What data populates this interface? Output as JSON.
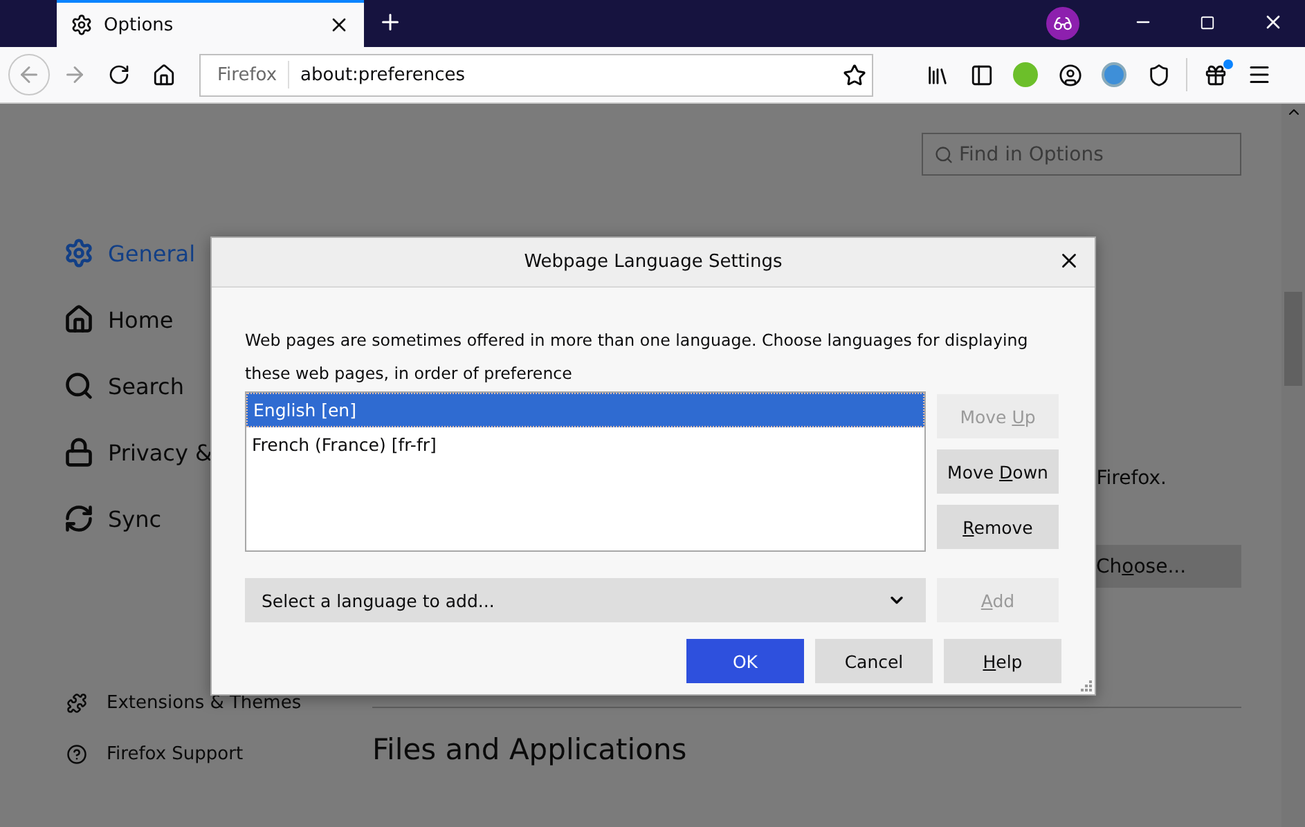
{
  "tab": {
    "title": "Options",
    "selected": true
  },
  "address_bar": {
    "identity": "Firefox",
    "url": "about:preferences"
  },
  "search": {
    "placeholder": "Find in Options"
  },
  "sidebar": {
    "items": [
      {
        "label": "General",
        "selected": true
      },
      {
        "label": "Home",
        "selected": false
      },
      {
        "label": "Search",
        "selected": false
      },
      {
        "label": "Privacy & ",
        "selected": false
      },
      {
        "label": "Sync",
        "selected": false
      }
    ],
    "footer_links": [
      "Extensions & Themes",
      "Firefox Support"
    ]
  },
  "content": {
    "text_fragment": "Firefox.",
    "choose_button": {
      "before": "Ch",
      "key": "o",
      "after": "ose..."
    },
    "section_heading": "Files and Applications"
  },
  "dialog": {
    "title": "Webpage Language Settings",
    "description": "Web pages are sometimes offered in more than one language. Choose languages for displaying these web pages, in order of preference",
    "languages": [
      {
        "label": "English [en]",
        "selected": true
      },
      {
        "label": "French (France) [fr-fr]",
        "selected": false
      }
    ],
    "side_buttons": [
      {
        "before": "Move ",
        "key": "U",
        "after": "p",
        "disabled": true
      },
      {
        "before": "Move ",
        "key": "D",
        "after": "own",
        "disabled": false
      },
      {
        "key": "R",
        "after": "emove",
        "disabled": false
      }
    ],
    "add_select": {
      "placeholder": "Select a language to add..."
    },
    "add_button": {
      "key": "A",
      "after": "dd",
      "disabled": true
    },
    "footer_buttons": [
      {
        "before": "OK",
        "kind": "primary"
      },
      {
        "before": "Cancel",
        "kind": "default"
      },
      {
        "key": "H",
        "after": "elp",
        "kind": "default"
      }
    ]
  }
}
